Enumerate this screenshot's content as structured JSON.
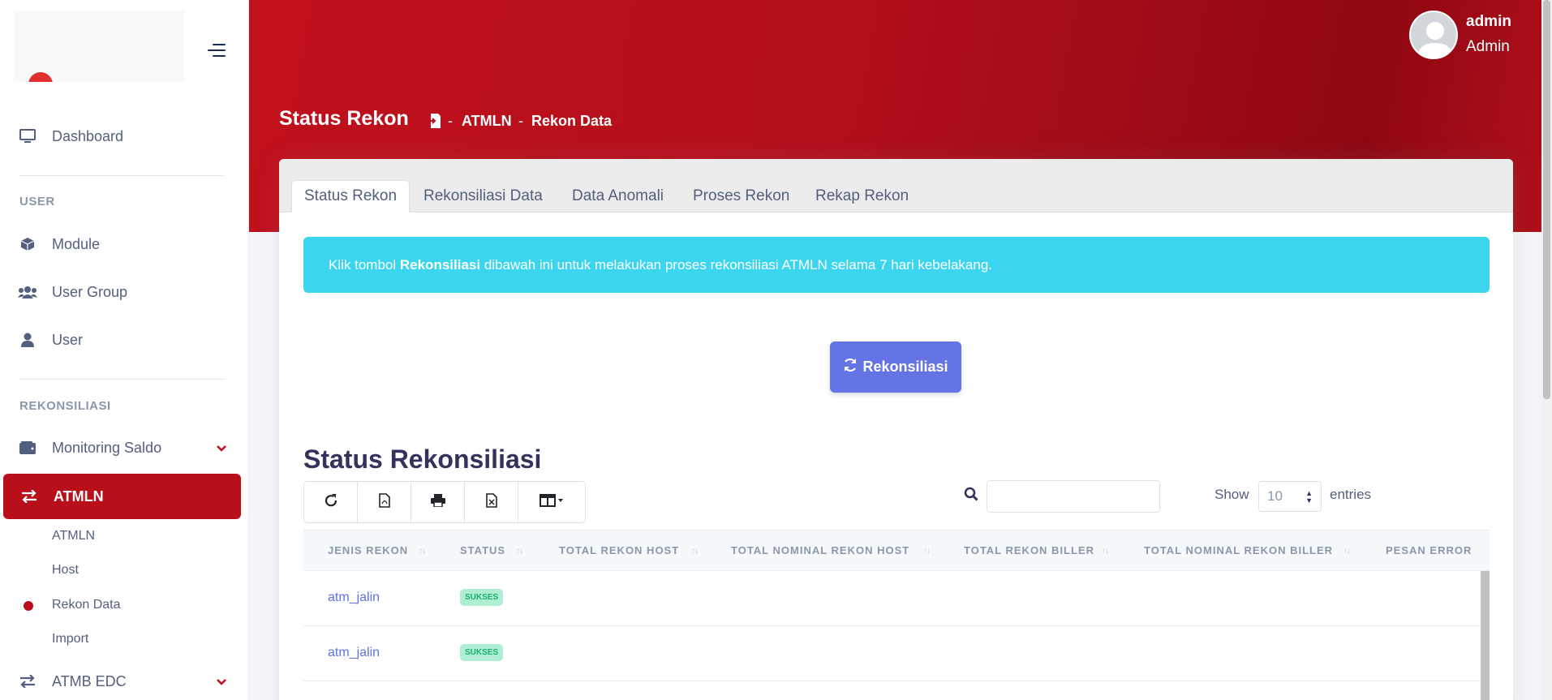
{
  "user": {
    "name": "admin",
    "role": "Admin"
  },
  "page": {
    "title": "Status Rekon",
    "breadcrumb": [
      "ATMLN",
      "Rekon Data"
    ],
    "breadcrumb_sep": "-"
  },
  "sidebar": {
    "dashboard": "Dashboard",
    "section_user": "USER",
    "module": "Module",
    "user_group": "User Group",
    "user": "User",
    "section_rekon": "REKONSILIASI",
    "monitoring_saldo": "Monitoring Saldo",
    "atmln": "ATMLN",
    "sub_items": [
      "ATMLN",
      "Host",
      "Rekon Data",
      "Import"
    ],
    "atmb_edc": "ATMB EDC"
  },
  "tabs": [
    "Status Rekon",
    "Rekonsiliasi Data",
    "Data Anomali",
    "Proses Rekon",
    "Rekap Rekon"
  ],
  "alert": {
    "prefix": "Klik tombol ",
    "bold": "Rekonsiliasi",
    "suffix": " dibawah ini untuk melakukan proses rekonsiliasi ATMLN selama 7 hari kebelakang."
  },
  "rekon_button": "Rekonsiliasi",
  "section_title": "Status Rekonsiliasi",
  "table_controls": {
    "search_placeholder": "",
    "show_label": "Show",
    "show_value": "10",
    "entries_label": "entries"
  },
  "table": {
    "columns": [
      "JENIS REKON",
      "STATUS",
      "TOTAL REKON HOST",
      "TOTAL NOMINAL REKON HOST",
      "TOTAL REKON BILLER",
      "TOTAL NOMINAL REKON BILLER",
      "PESAN ERROR"
    ],
    "rows": [
      {
        "jenis": "atm_jalin",
        "status": "SUKSES"
      },
      {
        "jenis": "atm_jalin",
        "status": "SUKSES"
      }
    ]
  },
  "colors": {
    "brand_red": "#b80f1a",
    "info": "#3bd5f0",
    "primary": "#6474e4",
    "success_bg": "#b0eed3",
    "success_text": "#1aae6f"
  }
}
